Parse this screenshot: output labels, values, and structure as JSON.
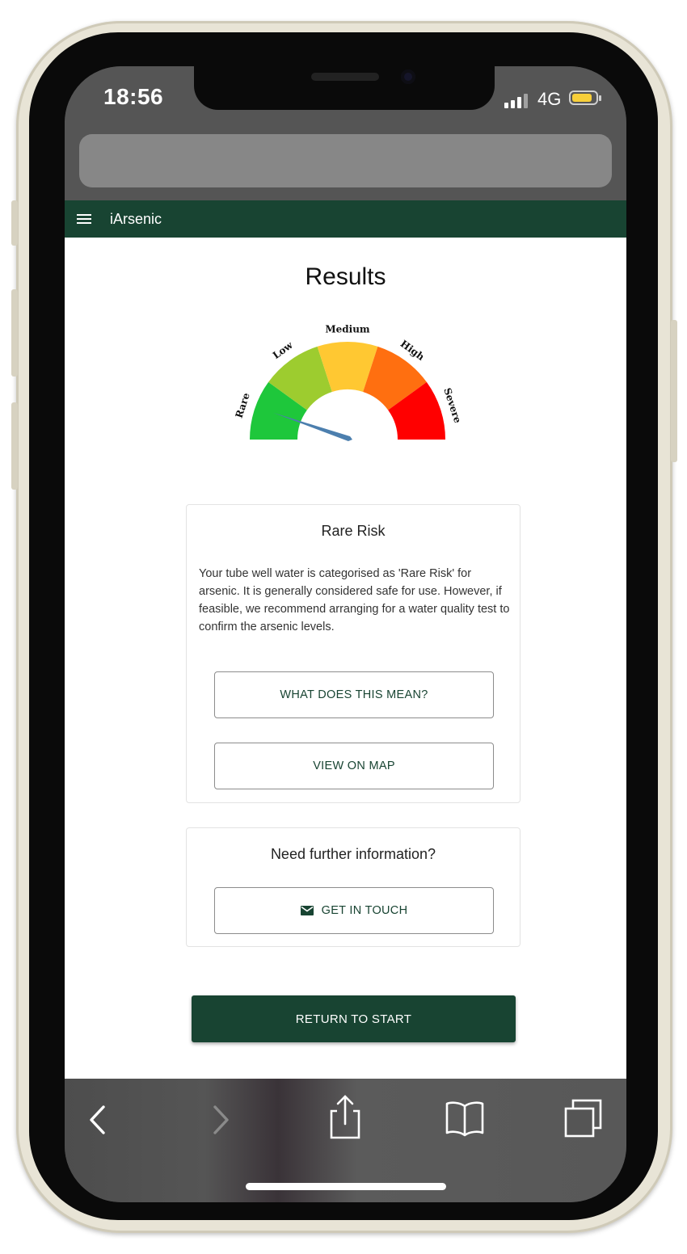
{
  "status_bar": {
    "time": "18:56",
    "network": "4G"
  },
  "app_bar": {
    "title": "iArsenic"
  },
  "page": {
    "title": "Results"
  },
  "gauge": {
    "labels": [
      "Rare",
      "Low",
      "Medium",
      "High",
      "Severe"
    ],
    "colors": [
      "#1ec73b",
      "#9dcc2f",
      "#ffc832",
      "#ff6f10",
      "#ff0000"
    ],
    "needle_color": "#4c7fae",
    "current_level": "Rare"
  },
  "risk_card": {
    "title": "Rare Risk",
    "description": "Your tube well water is categorised as 'Rare Risk' for arsenic. It is generally considered safe for use. However, if feasible, we recommend arranging for a water quality test to confirm the arsenic levels.",
    "buttons": {
      "what_does_this_mean": "WHAT DOES THIS MEAN?",
      "view_on_map": "VIEW ON MAP"
    }
  },
  "info_card": {
    "title": "Need further information?",
    "contact_button": "GET IN TOUCH"
  },
  "return_button": "RETURN TO START",
  "colors": {
    "brand": "#184432"
  }
}
